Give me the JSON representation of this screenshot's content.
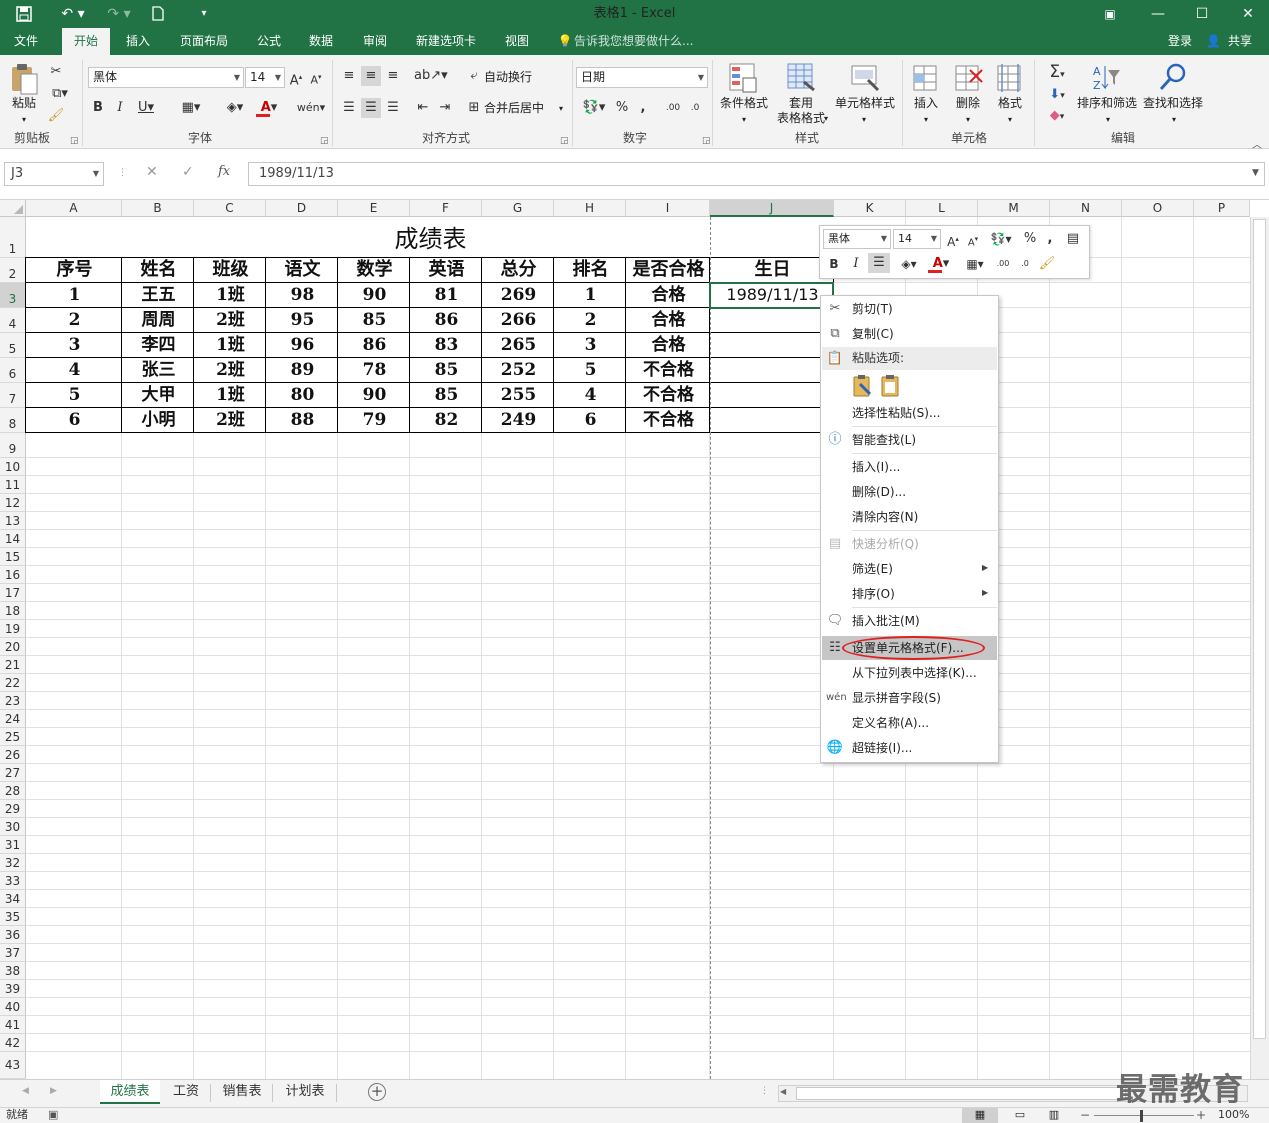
{
  "app": {
    "title": "表格1 - Excel",
    "login": "登录",
    "share": "共享"
  },
  "ribbon_tabs": [
    "文件",
    "开始",
    "插入",
    "页面布局",
    "公式",
    "数据",
    "审阅",
    "新建选项卡",
    "视图"
  ],
  "tell_me": "告诉我您想要做什么...",
  "ribbon": {
    "paste": "粘贴",
    "font_name": "黑体",
    "font_size": "14",
    "wrap_text": "自动换行",
    "merge_center": "合并后居中",
    "number_format": "日期",
    "conditional_format": "条件格式",
    "table_format": [
      "套用",
      "表格格式"
    ],
    "cell_styles": "单元格样式",
    "insert": "插入",
    "delete": "删除",
    "format": "格式",
    "sort_filter": "排序和筛选",
    "find_select": "查找和选择",
    "groups": {
      "clipboard": "剪贴板",
      "font": "字体",
      "alignment": "对齐方式",
      "number": "数字",
      "styles": "样式",
      "cells": "单元格",
      "editing": "编辑"
    }
  },
  "formula_bar": {
    "name_box": "J3",
    "fx": "fx",
    "content": "1989/11/13"
  },
  "columns": [
    "A",
    "B",
    "C",
    "D",
    "E",
    "F",
    "G",
    "H",
    "I",
    "J",
    "K",
    "L",
    "M",
    "N",
    "O",
    "P"
  ],
  "rows": [
    "1",
    "2",
    "3",
    "4",
    "5",
    "6",
    "7",
    "8",
    "9",
    "10",
    "11",
    "12",
    "13",
    "14",
    "15",
    "16",
    "17",
    "18",
    "19",
    "20",
    "21",
    "22",
    "23",
    "24",
    "25",
    "26",
    "27",
    "28",
    "29",
    "30",
    "31",
    "32",
    "33",
    "34",
    "35",
    "36",
    "37",
    "38",
    "39",
    "40",
    "41",
    "42",
    "43"
  ],
  "sheet": {
    "title": "成绩表",
    "headers": [
      "序号",
      "姓名",
      "班级",
      "语文",
      "数学",
      "英语",
      "总分",
      "排名",
      "是否合格",
      "生日"
    ],
    "rows": [
      [
        "1",
        "王五",
        "1班",
        "98",
        "90",
        "81",
        "269",
        "1",
        "合格",
        "1989/11/13"
      ],
      [
        "2",
        "周周",
        "2班",
        "95",
        "85",
        "86",
        "266",
        "2",
        "合格",
        ""
      ],
      [
        "3",
        "李四",
        "1班",
        "96",
        "86",
        "83",
        "265",
        "3",
        "合格",
        ""
      ],
      [
        "4",
        "张三",
        "2班",
        "89",
        "78",
        "85",
        "252",
        "5",
        "不合格",
        ""
      ],
      [
        "5",
        "大甲",
        "1班",
        "80",
        "90",
        "85",
        "255",
        "4",
        "不合格",
        ""
      ],
      [
        "6",
        "小明",
        "2班",
        "88",
        "79",
        "82",
        "249",
        "6",
        "不合格",
        ""
      ]
    ]
  },
  "mini_toolbar": {
    "font_name": "黑体",
    "font_size": "14"
  },
  "context_menu": {
    "cut": "剪切(T)",
    "copy": "复制(C)",
    "paste_options": "粘贴选项:",
    "paste_special": "选择性粘贴(S)...",
    "smart_lookup": "智能查找(L)",
    "insert": "插入(I)...",
    "delete": "删除(D)...",
    "clear": "清除内容(N)",
    "quick_analysis": "快速分析(Q)",
    "filter": "筛选(E)",
    "sort": "排序(O)",
    "insert_comment": "插入批注(M)",
    "format_cells": "设置单元格格式(F)...",
    "pick_list": "从下拉列表中选择(K)...",
    "phonetic": "显示拼音字段(S)",
    "define_name": "定义名称(A)...",
    "hyperlink": "超链接(I)..."
  },
  "sheet_tabs": [
    "成绩表",
    "工资",
    "销售表",
    "计划表"
  ],
  "status": {
    "ready": "就绪",
    "zoom": "100%"
  },
  "watermark": "最需教育",
  "colors": {
    "excel_green": "#217346",
    "highlight_red": "#e02020"
  }
}
